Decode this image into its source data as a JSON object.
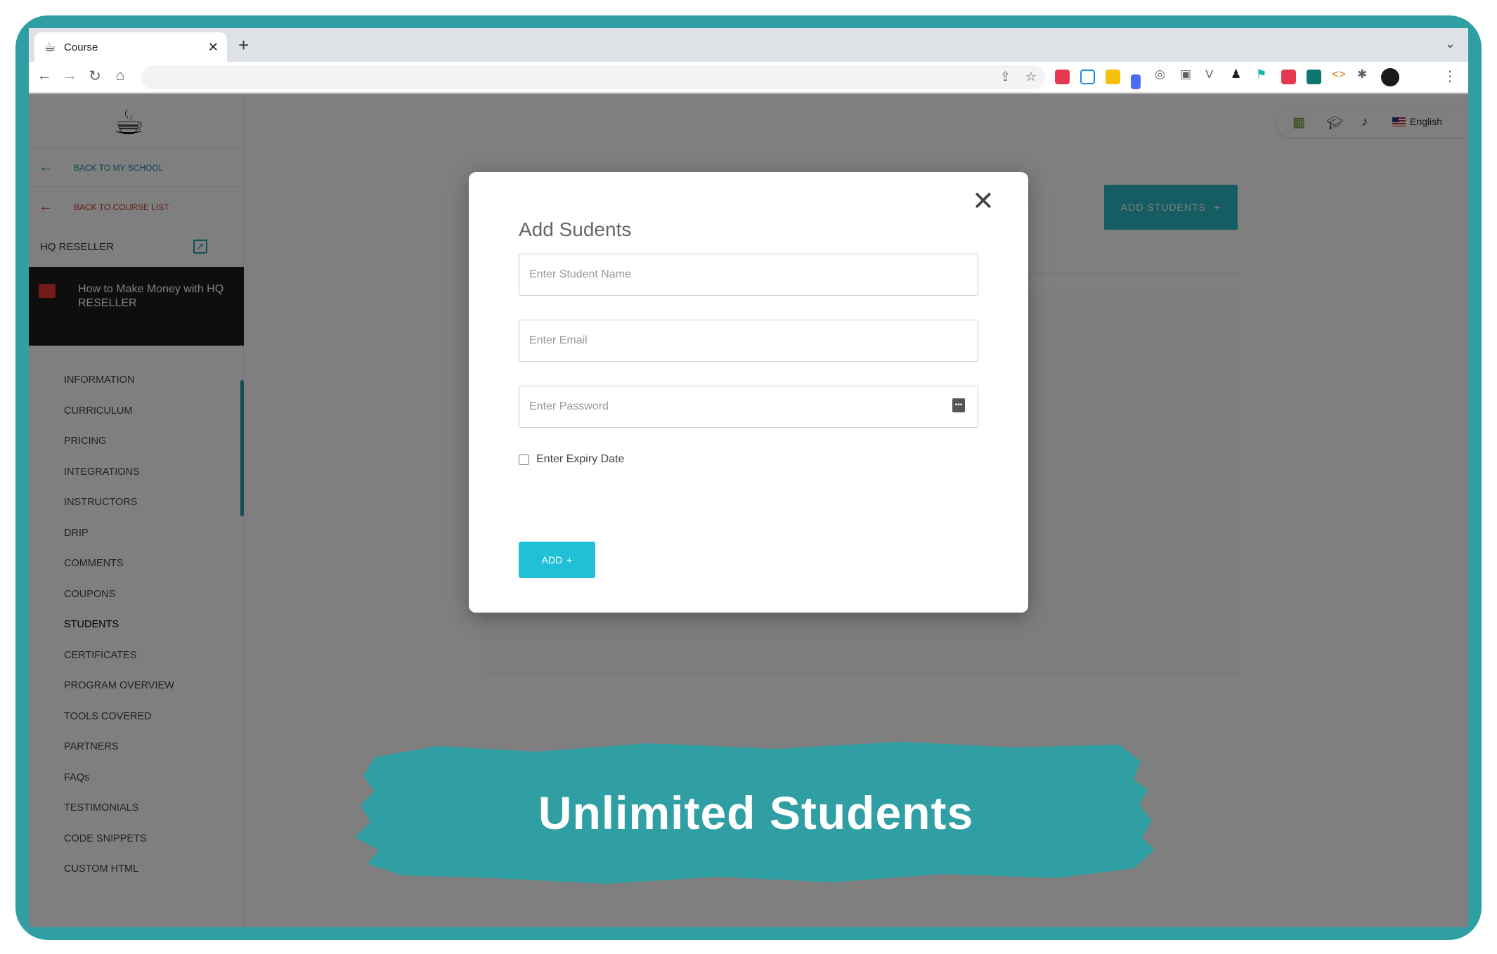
{
  "browser": {
    "tab_title": "Course",
    "tab_favicon": "☕",
    "url": ". . . . . . . . . . ."
  },
  "sidebar": {
    "back_to_school": "BACK TO MY SCHOOL",
    "back_to_course_list": "BACK TO COURSE LIST",
    "school_name": "HQ RESELLER",
    "course_title": "How to Make Money with HQ RESELLER",
    "menu": [
      "INFORMATION",
      "CURRICULUM",
      "PRICING",
      "INTEGRATIONS",
      "INSTRUCTORS",
      "DRIP",
      "COMMENTS",
      "COUPONS",
      "STUDENTS",
      "CERTIFICATES",
      "PROGRAM OVERVIEW",
      "TOOLS COVERED",
      "PARTNERS",
      "FAQs",
      "TESTIMONIALS",
      "CODE SNIPPETS",
      "CUSTOM HTML"
    ],
    "active_item": "STUDENTS"
  },
  "header": {
    "language": "English"
  },
  "main": {
    "add_students_label": "ADD STUDENTS"
  },
  "modal": {
    "title": "Add Sudents",
    "name_placeholder": "Enter Student Name",
    "email_placeholder": "Enter Email",
    "password_placeholder": "Enter Password",
    "expiry_label": "Enter Expiry Date",
    "add_label": "ADD"
  },
  "banner": {
    "text": "Unlimited Students",
    "color": "#2f9fa3"
  },
  "colors": {
    "accent": "#22c0d6",
    "frame": "#2f9fa3",
    "back_school": "#1b8fa0",
    "back_course": "#c0392b"
  }
}
